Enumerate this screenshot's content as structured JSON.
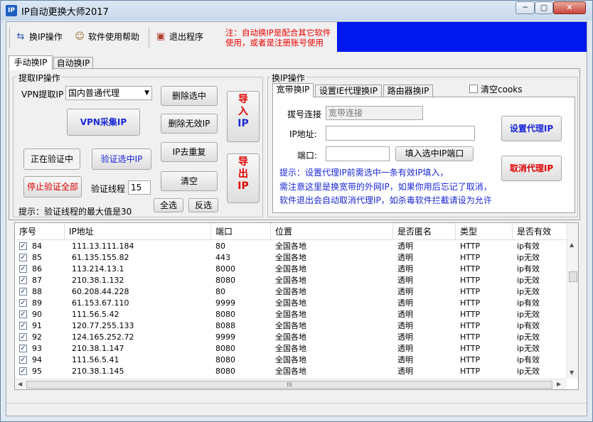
{
  "window": {
    "title": "IP自动更换大师2017",
    "app_icon": "IP",
    "controls": [
      "─",
      "▢",
      "✕"
    ]
  },
  "toolbar": {
    "switch_ip": "换IP操作",
    "help": "软件使用帮助",
    "exit": "退出程序",
    "notice_line1": "注：自动换IP是配合其它软件",
    "notice_line2": "使用，或者是注册账号使用"
  },
  "tabs": [
    "手动换IP",
    "自动换IP"
  ],
  "extract": {
    "group_title": "提取IP操作",
    "vpn_label": "VPN提取IP",
    "vpn_value": "国内普通代理",
    "collect_btn": "VPN采集IP",
    "delete_selected": "删除选中",
    "delete_invalid": "删除无效IP",
    "dedupe": "IP去重复",
    "clear": "清空",
    "verifying": "正在验证中",
    "verify_selected": "验证选中IP",
    "stop_verify": "停止验证全部",
    "threads_label": "验证线程",
    "threads_value": "15",
    "select_all": "全选",
    "invert": "反选",
    "hint": "提示：验证线程的最大值是30",
    "import_chars": [
      "导",
      "入",
      "IP"
    ],
    "export_chars": [
      "导",
      "出",
      "IP"
    ]
  },
  "switch": {
    "group_title": "换IP操作",
    "tabs": [
      "宽带换IP",
      "设置IE代理换IP",
      "路由器换IP"
    ],
    "clear_cookies": "清空cooks",
    "dial_label": "拔号连接",
    "dial_placeholder": "宽带连接",
    "ip_label": "IP地址:",
    "port_label": "端口:",
    "fill_btn": "填入选中IP端口",
    "set_proxy": "设置代理IP",
    "cancel_proxy": "取消代理IP",
    "hint1": "提示：设置代理IP前需选中一条有效IP填入，",
    "hint2": "需注意这里是换宽带的外网IP，如果你用后忘记了取消，",
    "hint3": "软件退出会自动取消代理IP，如杀毒软件拦截请设为允许"
  },
  "table": {
    "columns": [
      "序号",
      "IP地址",
      "端口",
      "位置",
      "是否匿名",
      "类型",
      "是否有效"
    ],
    "rows": [
      [
        "84",
        "111.13.111.184",
        "80",
        "全国各地",
        "透明",
        "HTTP",
        "ip有效"
      ],
      [
        "85",
        "61.135.155.82",
        "443",
        "全国各地",
        "透明",
        "HTTP",
        "ip无效"
      ],
      [
        "86",
        "113.214.13.1",
        "8000",
        "全国各地",
        "透明",
        "HTTP",
        "ip有效"
      ],
      [
        "87",
        "210.38.1.132",
        "8080",
        "全国各地",
        "透明",
        "HTTP",
        "ip无效"
      ],
      [
        "88",
        "60.208.44.228",
        "80",
        "全国各地",
        "透明",
        "HTTP",
        "ip无效"
      ],
      [
        "89",
        "61.153.67.110",
        "9999",
        "全国各地",
        "透明",
        "HTTP",
        "ip有效"
      ],
      [
        "90",
        "111.56.5.42",
        "8080",
        "全国各地",
        "透明",
        "HTTP",
        "ip无效"
      ],
      [
        "91",
        "120.77.255.133",
        "8088",
        "全国各地",
        "透明",
        "HTTP",
        "ip有效"
      ],
      [
        "92",
        "124.165.252.72",
        "9999",
        "全国各地",
        "透明",
        "HTTP",
        "ip无效"
      ],
      [
        "93",
        "210.38.1.147",
        "8080",
        "全国各地",
        "透明",
        "HTTP",
        "ip无效"
      ],
      [
        "94",
        "111.56.5.41",
        "8080",
        "全国各地",
        "透明",
        "HTTP",
        "ip有效"
      ],
      [
        "95",
        "210.38.1.145",
        "8080",
        "全国各地",
        "透明",
        "HTTP",
        "ip无效"
      ]
    ],
    "hscroll_grip": "III"
  },
  "colors": {
    "banner": "#0017ee",
    "notice": "#ee0000",
    "hint": "#1a28d6",
    "danger": "#e00000",
    "primary_text": "#1a28d6"
  }
}
